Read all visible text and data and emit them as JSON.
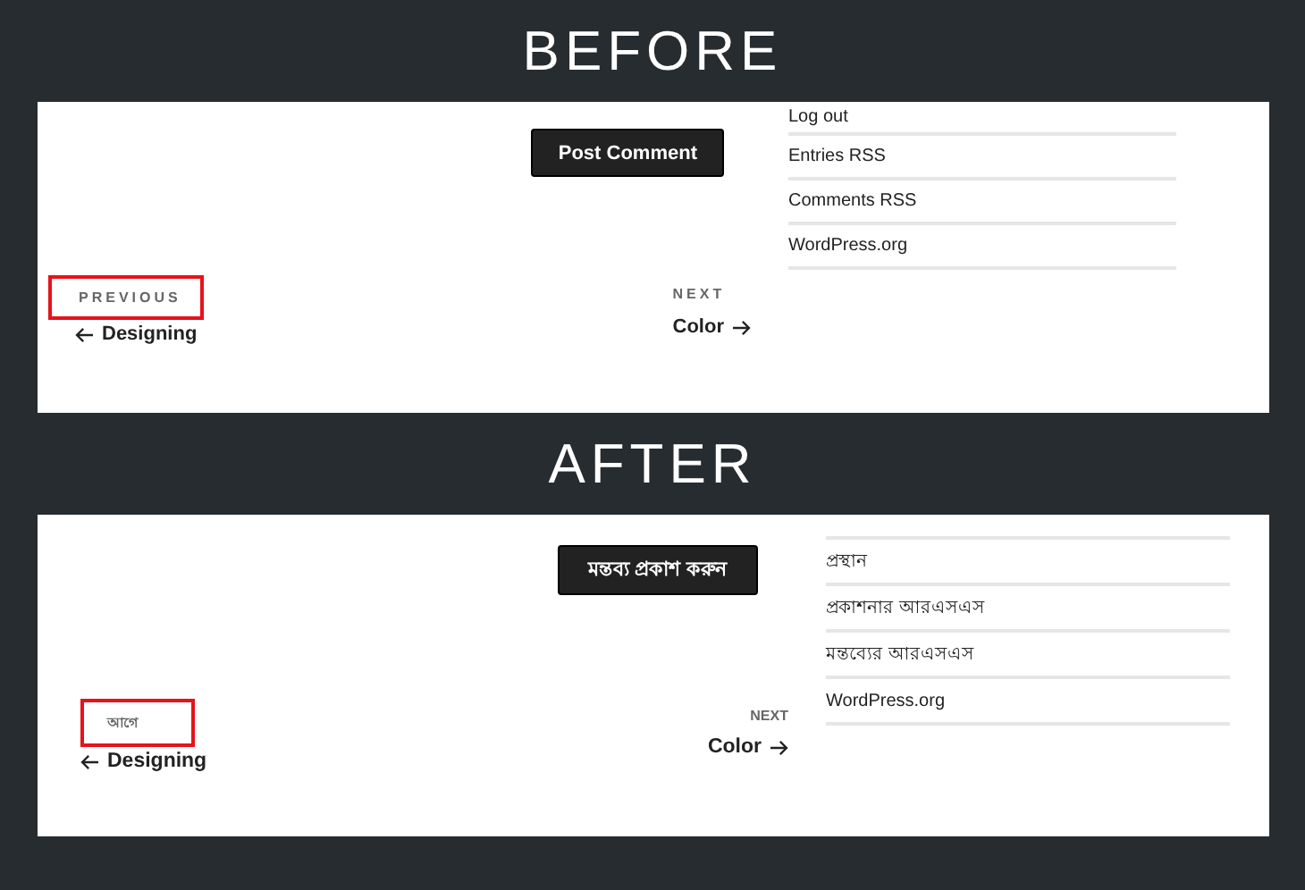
{
  "panels": [
    {
      "heading": "BEFORE",
      "button": "Post Comment",
      "links": [
        {
          "text": "Log out"
        },
        {
          "text": "Entries RSS"
        },
        {
          "text": "Comments RSS"
        },
        {
          "text": "WordPress.org"
        }
      ],
      "previous": {
        "label": "PREVIOUS",
        "title": "Designing",
        "highlighted": true
      },
      "next": {
        "label": "NEXT",
        "title": "Color"
      }
    },
    {
      "heading": "AFTER",
      "button": "মন্তব্য প্রকাশ করুন",
      "links": [
        {
          "text": "প্রস্থান"
        },
        {
          "text": "প্রকাশনার আরএসএস"
        },
        {
          "text": "মন্তব্যের আরএসএস"
        },
        {
          "text": "WordPress.org"
        }
      ],
      "previous": {
        "label": "আগে",
        "title": "Designing",
        "highlighted": true
      },
      "next": {
        "label": "NEXT",
        "title": "Color"
      }
    }
  ]
}
